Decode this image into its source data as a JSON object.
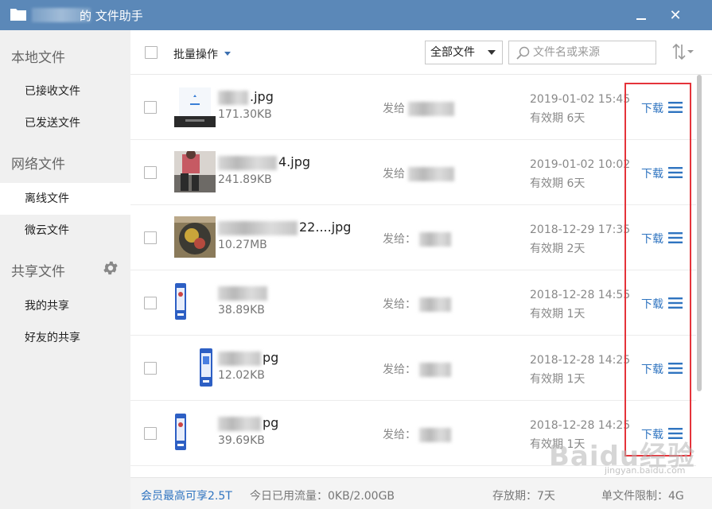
{
  "window": {
    "title": "的 文件助手",
    "icons": {
      "app": "folder-icon",
      "minimize": "minimize-icon",
      "close": "close-icon"
    }
  },
  "sidebar": {
    "groups": [
      {
        "label": "本地文件",
        "items": [
          "已接收文件",
          "已发送文件"
        ]
      },
      {
        "label": "网络文件",
        "items": [
          "离线文件",
          "微云文件"
        ]
      },
      {
        "label": "共享文件",
        "items": [
          "我的共享",
          "好友的共享"
        ]
      }
    ],
    "active_item": "离线文件"
  },
  "toolbar": {
    "batch_label": "批量操作",
    "filter_value": "全部文件",
    "search_placeholder": "文件名或来源"
  },
  "files": [
    {
      "name_suffix": ".jpg",
      "size": "171.30KB",
      "send_prefix": "发给",
      "date": "2019-01-02 15:45",
      "expire": "有效期 6天",
      "action": "下载"
    },
    {
      "name_suffix": "4.jpg",
      "size": "241.89KB",
      "send_prefix": "发给",
      "date": "2019-01-02 10:02",
      "expire": "有效期 6天",
      "action": "下载"
    },
    {
      "name_suffix": "22....jpg",
      "size": "10.27MB",
      "send_prefix": "发给：",
      "date": "2018-12-29 17:35",
      "expire": "有效期 2天",
      "action": "下载"
    },
    {
      "name_suffix": "",
      "size": "38.89KB",
      "send_prefix": "发给：",
      "date": "2018-12-28 14:55",
      "expire": "有效期 1天",
      "action": "下载"
    },
    {
      "name_suffix": "pg",
      "size": "12.02KB",
      "send_prefix": "发给：",
      "date": "2018-12-28 14:25",
      "expire": "有效期 1天",
      "action": "下载"
    },
    {
      "name_suffix": "pg",
      "size": "39.69KB",
      "send_prefix": "发给：",
      "date": "2018-12-28 14:25",
      "expire": "有效期 1天",
      "action": "下载"
    }
  ],
  "footer": {
    "vip": "会员最高可享2.5T",
    "traffic": "今日已用流量：0KB/2.00GB",
    "period": "存放期：7天",
    "limit": "单文件限制：4G"
  },
  "watermark": {
    "main": "Baidu经验",
    "sub": "jingyan.baidu.com"
  },
  "colors": {
    "titlebar": "#5b88b8",
    "link": "#2f74c0",
    "highlight_box": "#e5333a",
    "sidebar_bg": "#f0f0f0"
  }
}
